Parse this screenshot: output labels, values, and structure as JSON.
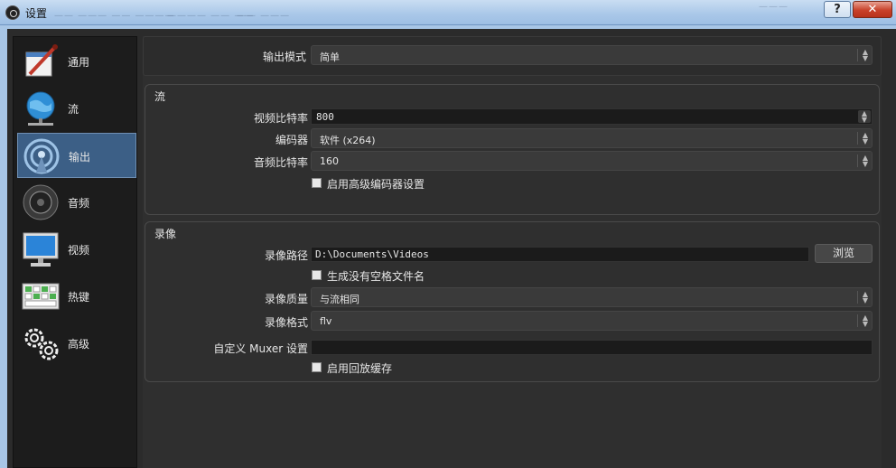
{
  "window": {
    "title": "设置",
    "help_button": "?",
    "close_button": "✕"
  },
  "sidebar": {
    "items": [
      {
        "label": "通用",
        "icon": "general-settings-icon"
      },
      {
        "label": "流",
        "icon": "globe-network-icon"
      },
      {
        "label": "输出",
        "icon": "broadcast-antenna-icon",
        "active": true
      },
      {
        "label": "音频",
        "icon": "speaker-icon"
      },
      {
        "label": "视频",
        "icon": "monitor-icon"
      },
      {
        "label": "热键",
        "icon": "keyboard-icon"
      },
      {
        "label": "高级",
        "icon": "gears-icon"
      }
    ]
  },
  "output_mode": {
    "label": "输出模式",
    "value": "简单"
  },
  "stream": {
    "title": "流",
    "video_bitrate": {
      "label": "视频比特率",
      "value": "800"
    },
    "encoder": {
      "label": "编码器",
      "value": "软件 (x264)"
    },
    "audio_bitrate": {
      "label": "音频比特率",
      "value": "160"
    },
    "advanced_encoder": {
      "label": "启用高级编码器设置",
      "checked": false
    }
  },
  "recording": {
    "title": "录像",
    "path": {
      "label": "录像路径",
      "value": "D:\\Documents\\Videos",
      "browse": "浏览"
    },
    "no_space_filename": {
      "label": "生成没有空格文件名",
      "checked": false
    },
    "quality": {
      "label": "录像质量",
      "value": "与流相同"
    },
    "format": {
      "label": "录像格式",
      "value": "flv"
    },
    "muxer": {
      "label": "自定义 Muxer 设置",
      "value": ""
    },
    "replay_buffer": {
      "label": "启用回放缓存",
      "checked": false
    }
  }
}
